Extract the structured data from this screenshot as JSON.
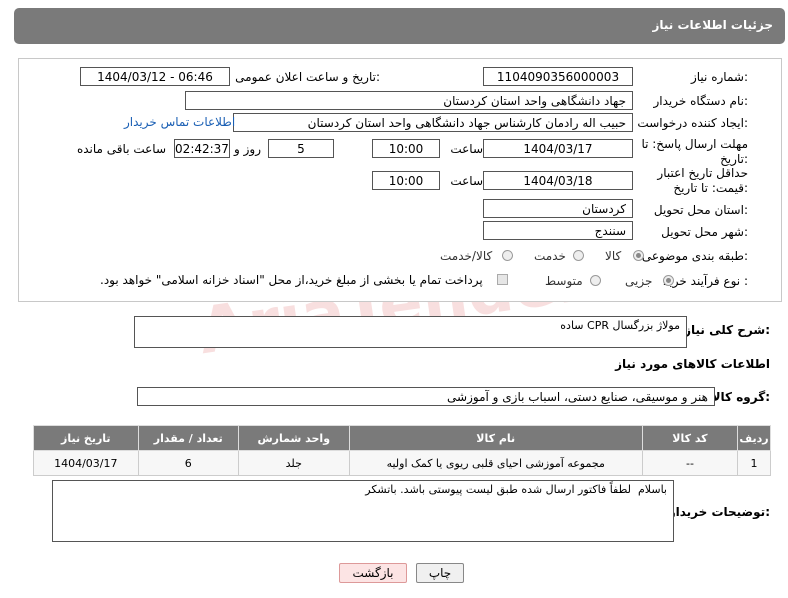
{
  "header": {
    "title": "جزئیات اطلاعات نیاز"
  },
  "form": {
    "need_number_label": "شماره نیاز:",
    "need_number": "1104090356000003",
    "announce_label": "تاریخ و ساعت اعلان عمومی:",
    "announce_value": "1404/03/12 - 06:46",
    "buyer_org_label": "نام دستگاه خریدار:",
    "buyer_org": "جهاد دانشگاهی واحد استان کردستان",
    "creator_label": "ایجاد کننده درخواست:",
    "creator": "حبیب اله رادمان کارشناس جهاد دانشگاهی واحد استان کردستان",
    "contact_link": "اطلاعات تماس خریدار",
    "deadline_label": "مهلت ارسال پاسخ: تا تاریخ:",
    "deadline_date": "1404/03/17",
    "time_label": "ساعت",
    "deadline_time": "10:00",
    "days_value": "5",
    "days_label": "روز و",
    "remaining_time": "02:42:37",
    "remaining_label": "ساعت باقی مانده",
    "min_price_label": "حداقل تاریخ اعتبار قیمت: تا تاریخ:",
    "min_price_date": "1404/03/18",
    "min_price_time": "10:00",
    "province_label": "استان محل تحویل:",
    "province": "کردستان",
    "city_label": "شهر محل تحویل:",
    "city": "سنندج",
    "category_label": "طبقه بندی موضوعی:",
    "category_options": [
      "کالا",
      "خدمت",
      "کالا/خدمت"
    ],
    "category_selected": "کالا",
    "process_label": "نوع فرآیند خرید :",
    "process_options": [
      "جزیی",
      "متوسط"
    ],
    "process_selected": "جزیی",
    "payment_note": "پرداخت تمام یا بخشی از مبلغ خرید،از محل \"اسناد خزانه اسلامی\" خواهد بود."
  },
  "description": {
    "label": "شرح کلی نیاز:",
    "text": "مولاژ بزرگسال CPR ساده"
  },
  "goods_info_title": "اطلاعات کالاهای مورد نیاز",
  "goods_group": {
    "label": "گروه کالا:",
    "value": "هنر و موسیقی، صنایع دستی، اسباب بازی و آموزشی"
  },
  "table": {
    "headers": [
      "ردیف",
      "کد کالا",
      "نام کالا",
      "واحد شمارش",
      "تعداد / مقدار",
      "تاریخ نیاز"
    ],
    "rows": [
      [
        "1",
        "--",
        "مجموعه آموزشی احیای قلبی ریوی یا کمک اولیه",
        "جلد",
        "6",
        "1404/03/17"
      ]
    ]
  },
  "buyer_notes": {
    "label": "توضیحات خریدار:",
    "text": "باسلام  لطفاً فاکتور ارسال شده طبق لیست پیوستی باشد. باتشکر"
  },
  "buttons": {
    "print": "چاپ",
    "back": "بازگشت"
  },
  "watermark": "AriaTender.net"
}
